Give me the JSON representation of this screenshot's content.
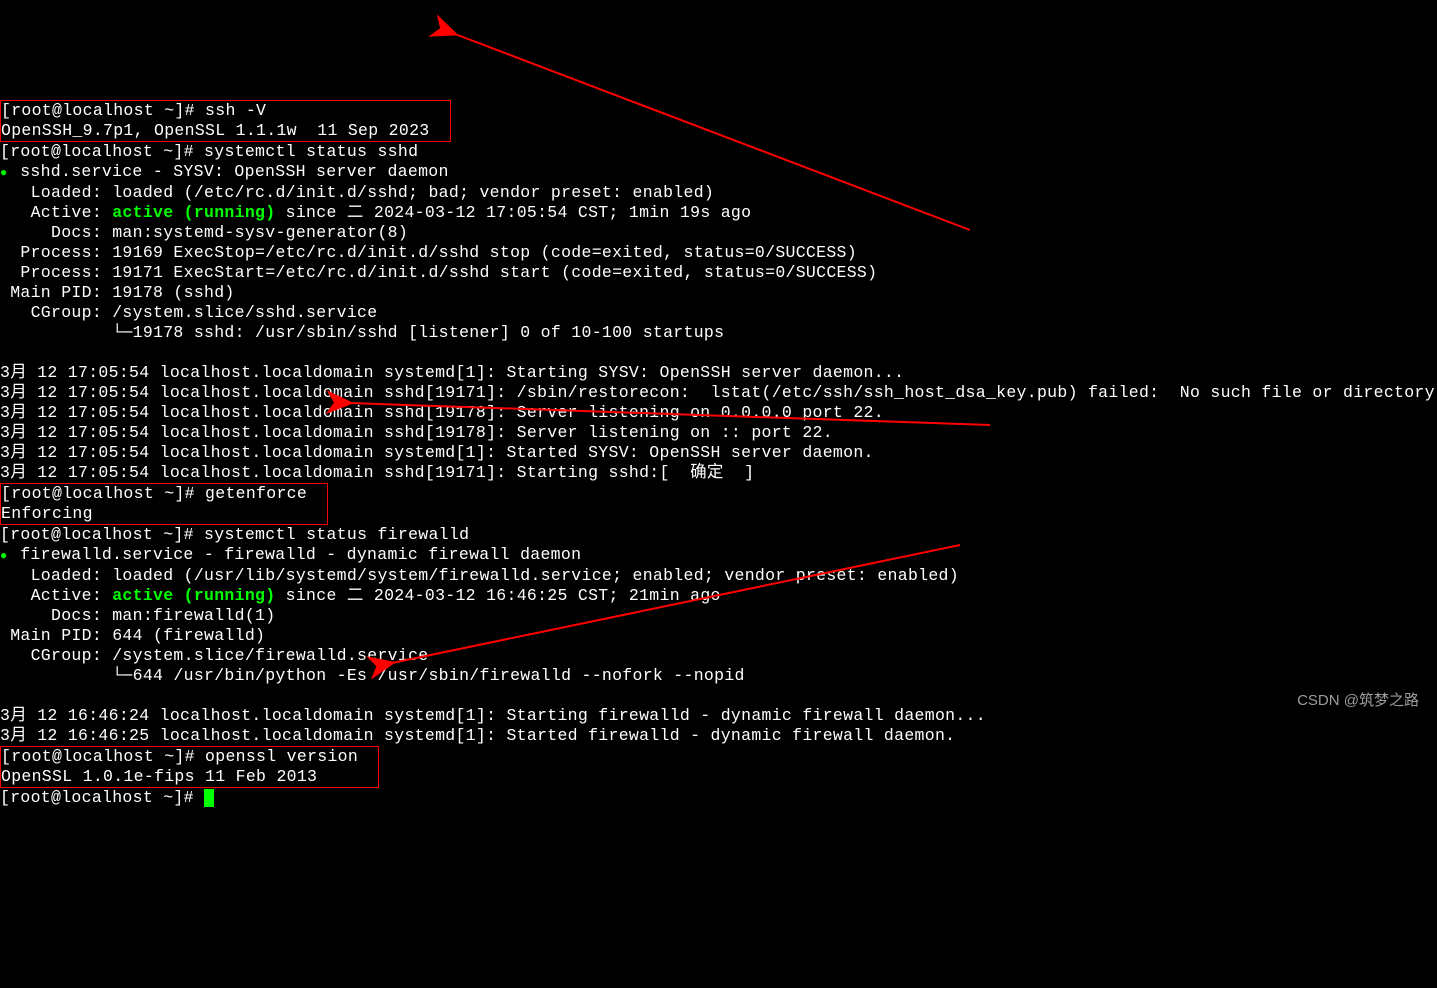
{
  "prompt": "[root@localhost ~]# ",
  "cmd": {
    "ssh_v": "ssh -V",
    "ssh_v_out": "OpenSSH_9.7p1, OpenSSL 1.1.1w  11 Sep 2023",
    "status_sshd": "systemctl status sshd",
    "getenforce": "getenforce",
    "getenforce_out": "Enforcing",
    "status_fw": "systemctl status firewalld",
    "openssl": "openssl version",
    "openssl_out": "OpenSSL 1.0.1e-fips 11 Feb 2013"
  },
  "sshd": {
    "unit_line": "sshd.service - SYSV: OpenSSH server daemon",
    "loaded": "   Loaded: loaded (/etc/rc.d/init.d/sshd; bad; vendor preset: enabled)",
    "active_prefix": "   Active: ",
    "active_green": "active (running)",
    "active_suffix": " since 二 2024-03-12 17:05:54 CST; 1min 19s ago",
    "docs": "     Docs: man:systemd-sysv-generator(8)",
    "proc1": "  Process: 19169 ExecStop=/etc/rc.d/init.d/sshd stop (code=exited, status=0/SUCCESS)",
    "proc2": "  Process: 19171 ExecStart=/etc/rc.d/init.d/sshd start (code=exited, status=0/SUCCESS)",
    "mainpid": " Main PID: 19178 (sshd)",
    "cgroup1": "   CGroup: /system.slice/sshd.service",
    "cgroup2": "           └─19178 sshd: /usr/sbin/sshd [listener] 0 of 10-100 startups",
    "log1": "3月 12 17:05:54 localhost.localdomain systemd[1]: Starting SYSV: OpenSSH server daemon...",
    "log2": "3月 12 17:05:54 localhost.localdomain sshd[19171]: /sbin/restorecon:  lstat(/etc/ssh/ssh_host_dsa_key.pub) failed:  No such file or directory",
    "log3": "3月 12 17:05:54 localhost.localdomain sshd[19178]: Server listening on 0.0.0.0 port 22.",
    "log4": "3月 12 17:05:54 localhost.localdomain sshd[19178]: Server listening on :: port 22.",
    "log5": "3月 12 17:05:54 localhost.localdomain systemd[1]: Started SYSV: OpenSSH server daemon.",
    "log6": "3月 12 17:05:54 localhost.localdomain sshd[19171]: Starting sshd:[  确定  ]"
  },
  "fw": {
    "unit_line": "firewalld.service - firewalld - dynamic firewall daemon",
    "loaded": "   Loaded: loaded (/usr/lib/systemd/system/firewalld.service; enabled; vendor preset: enabled)",
    "active_prefix": "   Active: ",
    "active_green": "active (running)",
    "active_suffix": " since 二 2024-03-12 16:46:25 CST; 21min ago",
    "docs": "     Docs: man:firewalld(1)",
    "mainpid": " Main PID: 644 (firewalld)",
    "cgroup1": "   CGroup: /system.slice/firewalld.service",
    "cgroup2": "           └─644 /usr/bin/python -Es /usr/sbin/firewalld --nofork --nopid",
    "log1": "3月 12 16:46:24 localhost.localdomain systemd[1]: Starting firewalld - dynamic firewall daemon...",
    "log2": "3月 12 16:46:25 localhost.localdomain systemd[1]: Started firewalld - dynamic firewall daemon."
  },
  "watermark": "CSDN @筑梦之路"
}
